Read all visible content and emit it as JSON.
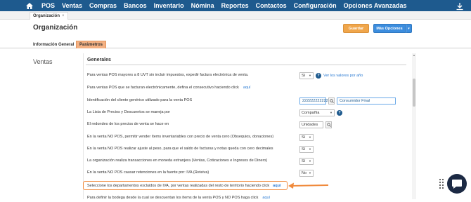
{
  "topnav": {
    "items": [
      "POS",
      "Ventas",
      "Compras",
      "Bancos",
      "Inventario",
      "Nómina",
      "Reportes",
      "Contactos",
      "Configuración",
      "Opciones Avanzadas"
    ]
  },
  "tab": {
    "label": "Organización",
    "close": "×"
  },
  "header": {
    "title": "Organización",
    "guardar": "Guardar",
    "mas_opciones": "Más Opciones",
    "caret": "▾"
  },
  "subtabs": {
    "general": "Información General",
    "parametros": "Parámetros"
  },
  "side_label": "Ventas",
  "section_title": "Generales",
  "rows": [
    {
      "label": "Para ventas POS mayores a 8 UVT sin incluir impuestos, expedir factura electrónica de venta.",
      "select": "Sí",
      "link": "Ver los valores por año"
    },
    {
      "label": "Para ventas POS que se facturan electrónicamente, defina el consecutivo haciendo click",
      "link": "aquí"
    },
    {
      "label": "Identificación del cliente genérico utilizado para la venta POS",
      "input": "222222222222",
      "input2": "Consumidor Final"
    },
    {
      "label": "La Lista de Precios y Descuentos se maneja por",
      "select": "Compañía"
    },
    {
      "label": "El redondeo de los precios de venta se hace en",
      "select": "Unidades"
    },
    {
      "label": "En la venta NO POS, permitir vender ítems inventariables con precio de venta cero (Obsequios, donaciones)",
      "select": "Sí"
    },
    {
      "label": "En la venta NO POS realizar ajuste al peso, para que el saldo de facturas y notas queda con cero decimales",
      "select": "Sí"
    },
    {
      "label": "La organización realiza transacciones en moneda extranjera (Ventas, Cotizaciones e Ingresos de Dinero)",
      "select": "Sí"
    },
    {
      "label": "En la venta NO POS causar retenciones en la fuente por: IVA (Reteiva)",
      "select": "No"
    },
    {
      "label": "Seleccione los departamentos excluidos de IVA, por ventas realizadas del resto de territorio haciendo click",
      "link": "aquí"
    },
    {
      "label": "Para definir la bodega desde la cual se descuentan los ítems de la venta POS y NO POS haga click",
      "link": "aquí"
    }
  ],
  "colors": {
    "nav": "#1e5a8e",
    "accent_orange": "#f08a3c",
    "link": "#2a7ad2",
    "guardar": "#f0a64b",
    "mas": "#3c8dde"
  }
}
